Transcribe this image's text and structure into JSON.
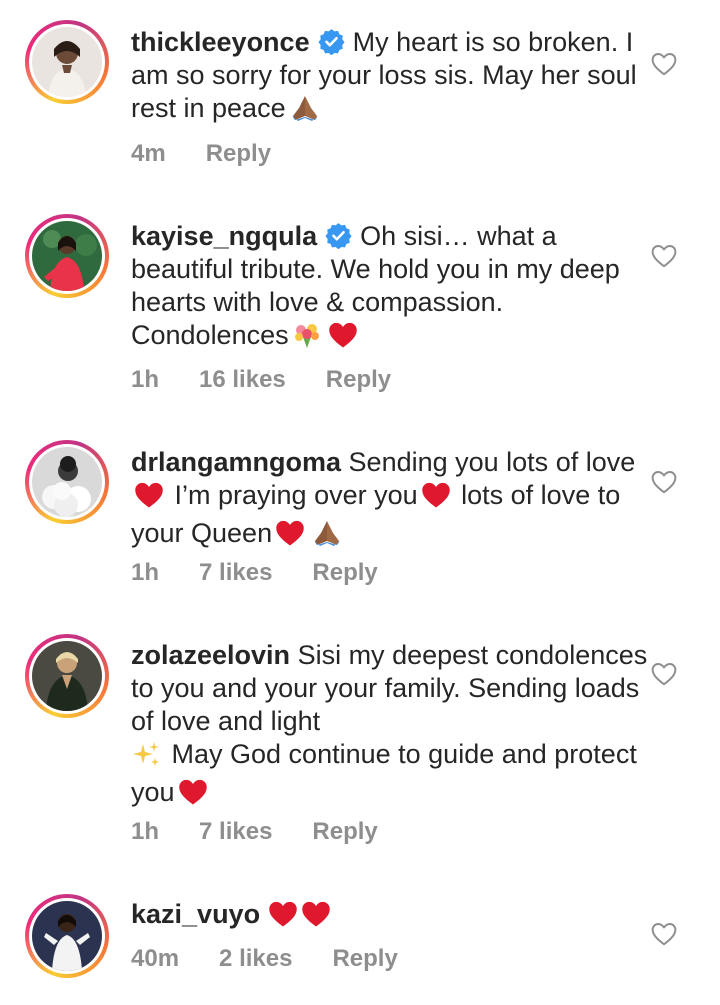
{
  "comments": [
    {
      "username": "thickleeyonce",
      "verified": true,
      "text_before": "My heart is so broken. I am so sorry for your loss sis. May her soul rest in peace",
      "time": "4m",
      "likes": "",
      "reply": "Reply"
    },
    {
      "username": "kayise_ngqula",
      "verified": true,
      "text_before": "Oh sisi… what a beautiful tribute. We hold you in my deep hearts with love & compassion. Condolences",
      "time": "1h",
      "likes": "16 likes",
      "reply": "Reply"
    },
    {
      "username": "drlangamngoma",
      "verified": false,
      "text_part1": "Sending you lots of love",
      "text_part2": "I’m praying over you",
      "text_part3": "lots of love to your Queen",
      "time": "1h",
      "likes": "7 likes",
      "reply": "Reply"
    },
    {
      "username": "zolazeelovin",
      "verified": false,
      "text_part1": "Sisi my deepest condolences to you and your your family. Sending loads of love and light",
      "text_part2": "May God continue to guide and protect you",
      "time": "1h",
      "likes": "7 likes",
      "reply": "Reply"
    },
    {
      "username": "kazi_vuyo",
      "verified": false,
      "time": "40m",
      "likes": "2 likes",
      "reply": "Reply"
    }
  ],
  "colors": {
    "text": "#262626",
    "meta": "#8e8e8e",
    "verified": "#3897f0",
    "heart_red": "#e0182d"
  },
  "icons": [
    "verified-badge-icon",
    "like-heart-outline-icon",
    "folded-hands-emoji",
    "red-heart-emoji",
    "bouquet-emoji",
    "sparkles-emoji"
  ]
}
